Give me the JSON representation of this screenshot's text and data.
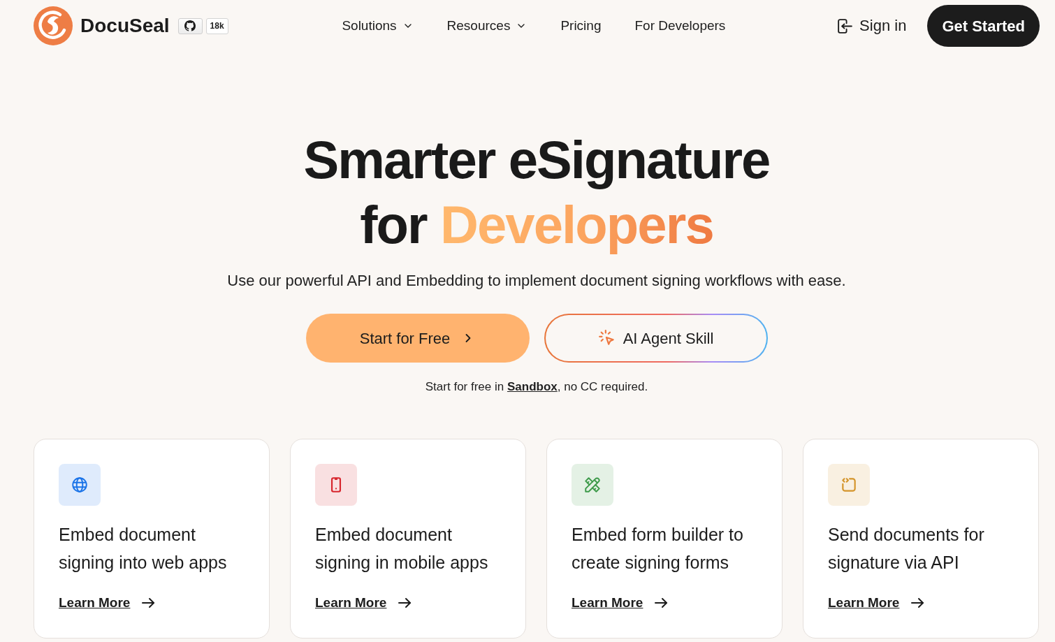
{
  "header": {
    "brand": "DocuSeal",
    "github_stars": "18k",
    "nav": [
      {
        "label": "Solutions",
        "kind": "menu"
      },
      {
        "label": "Resources",
        "kind": "menu"
      },
      {
        "label": "Pricing",
        "kind": "link"
      },
      {
        "label": "For Developers",
        "kind": "link"
      }
    ],
    "sign_in": "Sign in",
    "cta": "Get Started"
  },
  "hero": {
    "title_line_1": "Smarter eSignature",
    "title_line_2": "for",
    "title_accent": "Developers",
    "subtitle": "Use our powerful API and Embedding to implement document signing workflows with ease.",
    "buttons": [
      {
        "label": "Start for Free",
        "kind": "primary"
      },
      {
        "label": "AI Agent Skill",
        "kind": "outline"
      }
    ],
    "note": {
      "before": "Start for free in ",
      "link": "Sandbox",
      "after": ", no CC required."
    }
  },
  "cards": [
    {
      "kind": "web",
      "color": "#1a73e8",
      "title": "Embed document signing into web apps",
      "link": "Learn More"
    },
    {
      "kind": "mobile",
      "color": "#d7262e",
      "title": "Embed document signing in mobile apps",
      "link": "Learn More"
    },
    {
      "kind": "builder",
      "color": "#3d9a4a",
      "title": "Embed form builder to create signing forms",
      "link": "Learn More"
    },
    {
      "kind": "api",
      "color": "#d4942a",
      "title": "Send documents for signature via API",
      "link": "Learn More"
    }
  ]
}
